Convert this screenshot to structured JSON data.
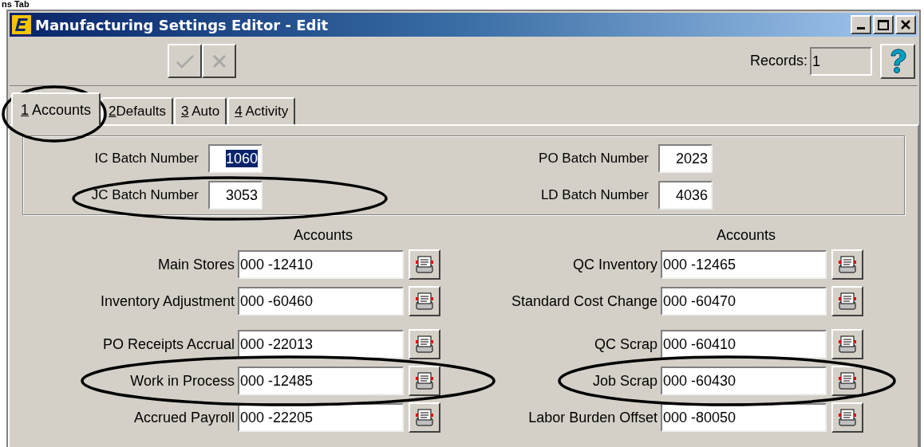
{
  "caption_fragment": "ns Tab",
  "window": {
    "title": "Manufacturing Settings Editor - Edit"
  },
  "toolbar": {
    "buttons": [
      {
        "kind": "confirm",
        "disabled": true
      },
      {
        "kind": "cancel",
        "disabled": true
      }
    ],
    "records_label": "Records:",
    "records_value": "1"
  },
  "tabs": [
    {
      "key": "1",
      "label": " Accounts",
      "selected": true
    },
    {
      "key": "2",
      "label": "Defaults",
      "selected": false
    },
    {
      "key": "3",
      "label": " Auto",
      "selected": false
    },
    {
      "key": "4",
      "label": " Activity",
      "selected": false
    }
  ],
  "batch_numbers": [
    [
      {
        "label": "IC Batch Number",
        "value": "1060",
        "selected": true
      },
      {
        "label": "JC Batch Number",
        "value": "3053",
        "selected": false
      }
    ],
    [
      {
        "label": "PO Batch Number",
        "value": "2023",
        "selected": false
      },
      {
        "label": "LD Batch Number",
        "value": "4036",
        "selected": false
      }
    ]
  ],
  "account_columns": [
    {
      "heading": "Accounts",
      "groups": [
        [
          {
            "label": "Main Stores",
            "value": "000 -12410"
          },
          {
            "label": "Inventory Adjustment",
            "value": "000 -60460"
          }
        ],
        [
          {
            "label": "PO Receipts Accrual",
            "value": "000 -22013"
          },
          {
            "label": "Work in Process",
            "value": "000 -12485"
          },
          {
            "label": "Accrued Payroll",
            "value": "000 -22205"
          }
        ]
      ]
    },
    {
      "heading": "Accounts",
      "groups": [
        [
          {
            "label": "QC Inventory",
            "value": "000 -12465"
          },
          {
            "label": "Standard Cost Change",
            "value": "000 -60470"
          }
        ],
        [
          {
            "label": "QC Scrap",
            "value": "000 -60410"
          },
          {
            "label": "Job Scrap",
            "value": "000 -60430"
          },
          {
            "label": "Labor Burden Offset",
            "value": "000 -80050"
          }
        ]
      ]
    }
  ]
}
